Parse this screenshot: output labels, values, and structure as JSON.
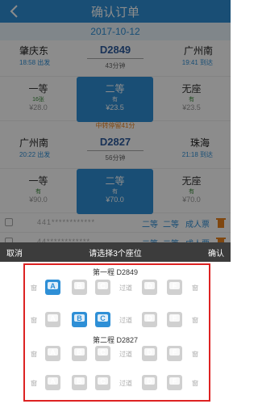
{
  "header": {
    "title": "确认订单"
  },
  "date": "2017-10-12",
  "legs": [
    {
      "from": "肇庆东",
      "from_time": "18:58 出发",
      "to": "广州南",
      "to_time": "19:41 到达",
      "train": "D2849",
      "duration": "43分钟",
      "seats": [
        {
          "cls": "一等",
          "avail": "16张",
          "price": "¥28.0"
        },
        {
          "cls": "二等",
          "avail": "有",
          "price": "¥23.5"
        },
        {
          "cls": "无座",
          "avail": "有",
          "price": "¥23.5"
        }
      ]
    },
    {
      "from": "广州南",
      "from_time": "20:22 出发",
      "to": "珠海",
      "to_time": "21:18 到达",
      "train": "D2827",
      "duration": "56分钟",
      "seats": [
        {
          "cls": "一等",
          "avail": "有",
          "price": "¥90.0"
        },
        {
          "cls": "二等",
          "avail": "有",
          "price": "¥70.0"
        },
        {
          "cls": "无座",
          "avail": "有",
          "price": "¥70.0"
        }
      ]
    }
  ],
  "transfer": "中转停留41分",
  "passengers": [
    {
      "id": "441************",
      "cls1": "二等",
      "cls2": "二等",
      "type": "成人票"
    },
    {
      "id": "44************",
      "cls1": "二等",
      "cls2": "二等",
      "type": "成人票"
    }
  ],
  "action_bar": {
    "cancel": "取消",
    "title": "请选择3个座位",
    "confirm": "确认"
  },
  "picker": {
    "leg1_title": "第一程 D2849",
    "leg2_title": "第二程 D2827",
    "window": "窗",
    "aisle": "过道",
    "letters": [
      "A",
      "B",
      "C",
      "D",
      "F"
    ]
  },
  "colors": {
    "accent": "#2e8fd6",
    "frame": "#dd2222",
    "transfer": "#e8821e"
  }
}
